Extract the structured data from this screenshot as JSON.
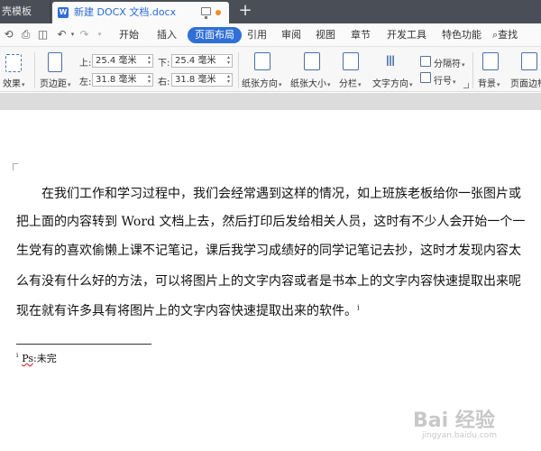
{
  "tabs": {
    "inactive_label": "壳模板",
    "active_label": "新建 DOCX 文档.docx",
    "doc_icon_letter": "W",
    "plus": "+"
  },
  "menu": {
    "quick_icons": [
      "undo-icon",
      "print-icon",
      "preview-icon",
      "undo-arrow-icon",
      "redo-arrow-icon"
    ],
    "items": [
      "开始",
      "插入",
      "页面布局",
      "引用",
      "审阅",
      "视图",
      "章节",
      "开发工具",
      "特色功能"
    ],
    "active_item": "页面布局",
    "search": "查找"
  },
  "ribbon": {
    "effects": "效果",
    "page_border": "页边距",
    "margins": {
      "top_label": "上:",
      "top_value": "25.4 毫米",
      "bottom_label": "下:",
      "bottom_value": "25.4 毫米",
      "left_label": "左:",
      "left_value": "31.8 毫米",
      "right_label": "右:",
      "right_value": "31.8 毫米"
    },
    "orientation": "纸张方向",
    "size": "纸张大小",
    "columns": "分栏",
    "text_direction": "文字方向",
    "separator": "分隔符",
    "line_numbers": "行号",
    "background": "背景",
    "page_border_right": "页面边框"
  },
  "document": {
    "lines": [
      "在我们工作和学习过程中，我们会经常遇到这样的情况，如上班族老板给你一张图片或",
      "把上面的内容转到 Word 文档上去，然后打印后发给相关人员，这时有不少人会开始一个一",
      "生党有的喜欢偷懒上课不记笔记，课后我学习成绩好的同学记笔记去抄，这时才发现内容太",
      "么有没有什么好的方法，可以将图片上的文字内容或者是书本上的文字内容快速提取出来呢",
      "现在就有许多具有将图片上的文字内容快速提取出来的软件。"
    ],
    "endnote_mark": "i",
    "footnote_mark": "i",
    "footnote_text_ps": "Ps",
    "footnote_text_rest": ":未完"
  },
  "watermark": {
    "main": "Bai 经验",
    "sub": "jingyan.baidu.com"
  }
}
